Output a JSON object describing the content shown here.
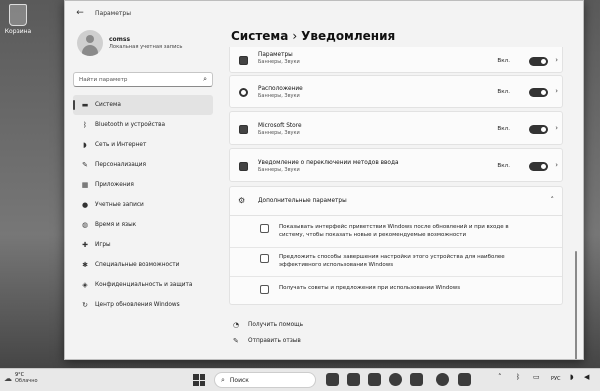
{
  "desktop": {
    "recycle_label": "Корзина"
  },
  "window": {
    "title": "Параметры"
  },
  "user": {
    "name": "comss",
    "account_type": "Локальная учетная запись"
  },
  "search": {
    "placeholder": "Найти параметр"
  },
  "nav": [
    {
      "label": "Система",
      "icon": "display-icon"
    },
    {
      "label": "Bluetooth и устройства",
      "icon": "bluetooth-icon"
    },
    {
      "label": "Сеть и Интернет",
      "icon": "wifi-icon"
    },
    {
      "label": "Персонализация",
      "icon": "brush-icon"
    },
    {
      "label": "Приложения",
      "icon": "apps-icon"
    },
    {
      "label": "Учетные записи",
      "icon": "person-icon"
    },
    {
      "label": "Время и язык",
      "icon": "globe-clock-icon"
    },
    {
      "label": "Игры",
      "icon": "gamepad-icon"
    },
    {
      "label": "Специальные возможности",
      "icon": "accessibility-icon"
    },
    {
      "label": "Конфиденциальность и защита",
      "icon": "shield-icon"
    },
    {
      "label": "Центр обновления Windows",
      "icon": "refresh-icon"
    }
  ],
  "breadcrumb": {
    "parent": "Система",
    "separator": "›",
    "current": "Уведомления"
  },
  "apps": [
    {
      "title": "Параметры",
      "subtitle": "Баннеры, Звуки",
      "state": "Вкл.",
      "icon": "gear-icon"
    },
    {
      "title": "Расположение",
      "subtitle": "Баннеры, Звуки",
      "state": "Вкл.",
      "icon": "location-icon"
    },
    {
      "title": "Microsoft Store",
      "subtitle": "Баннеры, Звуки",
      "state": "Вкл.",
      "icon": "store-icon"
    },
    {
      "title": "Уведомление о переключении методов ввода",
      "subtitle": "Баннеры, Звуки",
      "state": "Вкл.",
      "icon": "keyboard-icon"
    }
  ],
  "advanced": {
    "title": "Дополнительные параметры",
    "options": [
      {
        "label": "Показывать интерфейс приветствия Windows после обновлений и при входе в систему, чтобы показать новые и рекомендуемые возможности"
      },
      {
        "label": "Предложить способы завершения настройки этого устройства для наиболее эффективного использования Windows"
      },
      {
        "label": "Получать советы и предложения при использовании Windows"
      }
    ]
  },
  "links": {
    "help": "Получить помощь",
    "feedback": "Отправить отзыв"
  },
  "taskbar": {
    "temperature": "9°C",
    "weather": "Облачно",
    "search_label": "Поиск",
    "lang": "РУС"
  }
}
